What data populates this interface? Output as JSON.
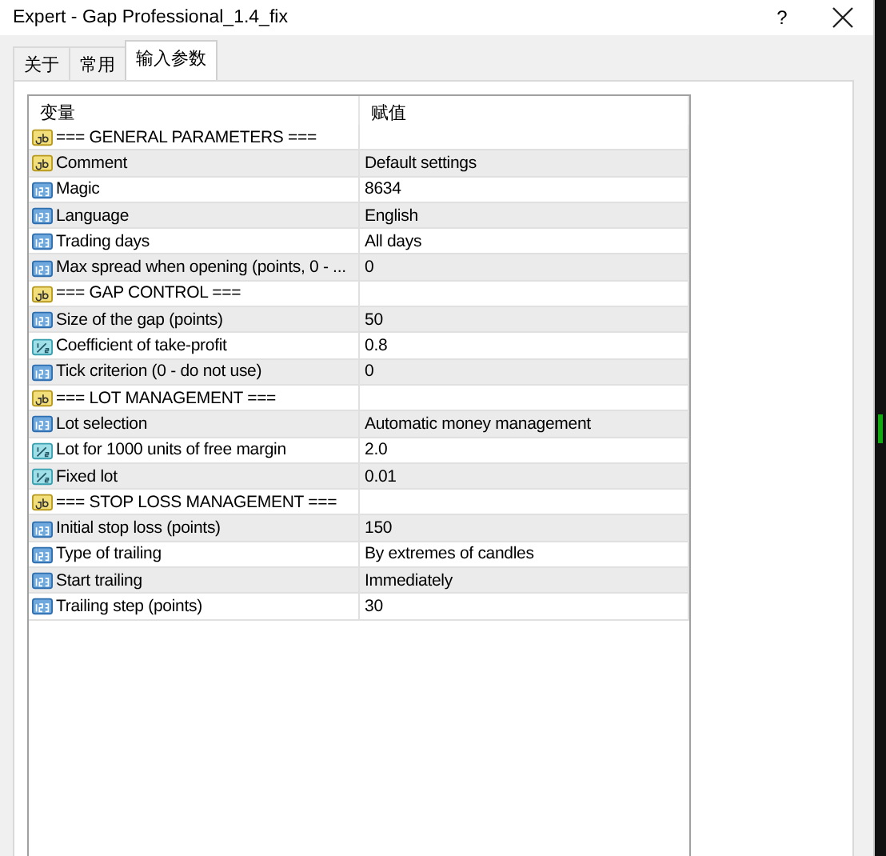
{
  "window": {
    "title": "Expert - Gap Professional_1.4_fix",
    "help_button": "?"
  },
  "tabs": [
    {
      "label": "关于",
      "selected": false
    },
    {
      "label": "常用",
      "selected": false
    },
    {
      "label": "输入参数",
      "selected": true
    }
  ],
  "table": {
    "columns": [
      "变量",
      "赋值"
    ],
    "rows": [
      {
        "kind": "string",
        "name": "=== GENERAL PARAMETERS ===",
        "value": ""
      },
      {
        "kind": "string",
        "name": "Comment",
        "value": "Default settings"
      },
      {
        "kind": "int",
        "name": "Magic",
        "value": "8634"
      },
      {
        "kind": "int",
        "name": "Language",
        "value": "English"
      },
      {
        "kind": "int",
        "name": "Trading days",
        "value": "All days"
      },
      {
        "kind": "int",
        "name": "Max spread when opening (points, 0 - ...",
        "value": "0"
      },
      {
        "kind": "string",
        "name": "=== GAP CONTROL ===",
        "value": ""
      },
      {
        "kind": "int",
        "name": "Size of the gap (points)",
        "value": "50"
      },
      {
        "kind": "double",
        "name": "Coefficient of take-profit",
        "value": "0.8"
      },
      {
        "kind": "int",
        "name": "Tick criterion (0 - do not use)",
        "value": "0"
      },
      {
        "kind": "string",
        "name": "=== LOT MANAGEMENT ===",
        "value": ""
      },
      {
        "kind": "int",
        "name": "Lot selection",
        "value": "Automatic money management"
      },
      {
        "kind": "double",
        "name": "Lot for 1000 units of free margin",
        "value": "2.0"
      },
      {
        "kind": "double",
        "name": "Fixed lot",
        "value": "0.01"
      },
      {
        "kind": "string",
        "name": "=== STOP LOSS MANAGEMENT ===",
        "value": ""
      },
      {
        "kind": "int",
        "name": "Initial stop loss (points)",
        "value": "150"
      },
      {
        "kind": "int",
        "name": "Type of trailing",
        "value": "By extremes of candles"
      },
      {
        "kind": "int",
        "name": "Start trailing",
        "value": "Immediately"
      },
      {
        "kind": "int",
        "name": "Trailing step (points)",
        "value": "30"
      }
    ]
  }
}
